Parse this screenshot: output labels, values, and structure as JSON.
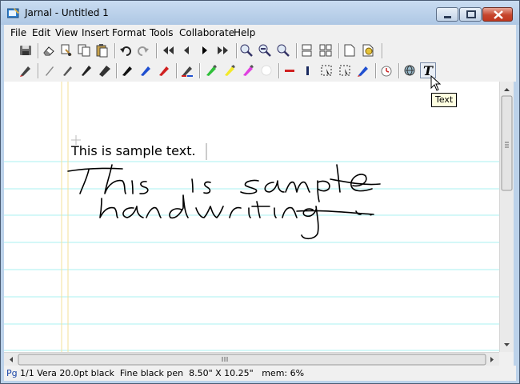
{
  "window": {
    "title": "Jarnal - Untitled 1"
  },
  "menu": [
    "File",
    "Edit",
    "View",
    "Insert",
    "Format",
    "Tools",
    "Collaborate",
    "Help"
  ],
  "toolbar1": [
    "save-icon",
    "eraser-icon",
    "cut-icon",
    "copy-icon",
    "paste-icon",
    "undo-icon",
    "redo-icon",
    "first-page-icon",
    "previous-page-icon",
    "next-page-icon",
    "last-page-icon",
    "zoom-in-icon",
    "zoom-out-icon",
    "zoom-fit-icon",
    "page-layout-icon",
    "grid-layout-icon",
    "new-page-icon",
    "settings-page-icon"
  ],
  "toolbar2": [
    "pen-color-icon",
    "fine-pencil-icon",
    "medium-pencil-icon",
    "thick-pencil-icon",
    "broad-pencil-icon",
    "black-pen-icon",
    "blue-pen-icon",
    "red-pen-icon",
    "pen-mix-icon",
    "green-highlighter-icon",
    "yellow-highlighter-icon",
    "magenta-highlighter-icon",
    "white-pen-icon",
    "red-line-icon",
    "blue-dash-icon",
    "select-rect-icon",
    "select-lasso-icon",
    "eraser-tool-icon",
    "clock-icon",
    "globe-icon",
    "text-tool-icon"
  ],
  "document": {
    "sample_text": "This is sample text."
  },
  "tooltip": {
    "text": "Text"
  },
  "status": {
    "page_label": "Pg",
    "details": "1/1 Vera 20.0pt black  Fine black pen  8.50\" X 10.25\"   mem: 6%"
  },
  "colors": {
    "rule_lines": "#a9f0f0",
    "margin_lines": "#f6e19a",
    "ink": "#000000"
  }
}
